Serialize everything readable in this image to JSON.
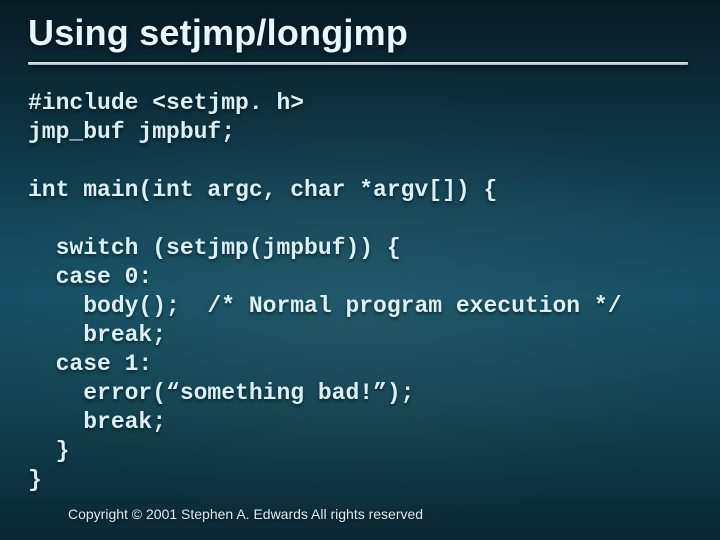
{
  "slide": {
    "title": "Using setjmp/longjmp",
    "code": "#include <setjmp. h>\njmp_buf jmpbuf;\n\nint main(int argc, char *argv[]) {\n\n  switch (setjmp(jmpbuf)) {\n  case 0:\n    body();  /* Normal program execution */\n    break;\n  case 1:\n    error(“something bad!”);\n    break;\n  }\n}",
    "footer": "Copyright © 2001 Stephen A. Edwards  All rights reserved"
  }
}
